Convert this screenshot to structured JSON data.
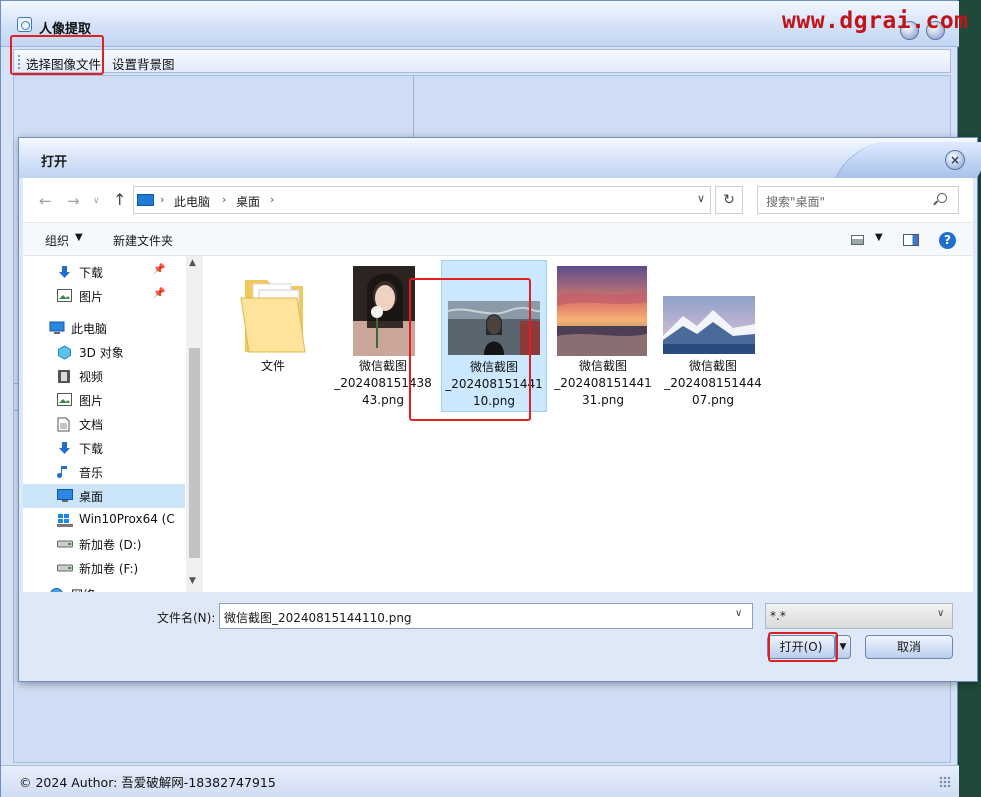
{
  "app": {
    "title": "人像提取",
    "watermark": "www.dgrai.com",
    "menu": {
      "select_image": "选择图像文件",
      "set_background": "设置背景图"
    },
    "status": "© 2024 Author: 吾爱破解网-18382747915"
  },
  "dialog": {
    "title": "打开",
    "close_glyph": "×",
    "breadcrumb": [
      "此电脑",
      "桌面"
    ],
    "search_placeholder": "搜索\"桌面\"",
    "toolbar": {
      "organize": "组织",
      "new_folder": "新建文件夹",
      "help": "?"
    },
    "nav_tree": [
      {
        "label": "下载",
        "icon": "download-arrow-icon",
        "pinned": true
      },
      {
        "label": "图片",
        "icon": "picture-icon",
        "pinned": true
      },
      {
        "label": "此电脑",
        "icon": "computer-icon",
        "pinned": false
      },
      {
        "label": "3D 对象",
        "icon": "cube-3d-icon",
        "pinned": false
      },
      {
        "label": "视频",
        "icon": "film-icon",
        "pinned": false
      },
      {
        "label": "图片",
        "icon": "picture-icon",
        "pinned": false
      },
      {
        "label": "文档",
        "icon": "document-icon",
        "pinned": false
      },
      {
        "label": "下载",
        "icon": "download-arrow-icon",
        "pinned": false
      },
      {
        "label": "音乐",
        "icon": "music-note-icon",
        "pinned": false
      },
      {
        "label": "桌面",
        "icon": "desktop-icon",
        "pinned": false,
        "selected": true
      },
      {
        "label": "Win10Prox64 (C",
        "icon": "windows-drive-icon",
        "pinned": false
      },
      {
        "label": "新加卷 (D:)",
        "icon": "drive-icon",
        "pinned": false
      },
      {
        "label": "新加卷 (F:)",
        "icon": "drive-icon",
        "pinned": false
      },
      {
        "label": "网络",
        "icon": "network-icon",
        "pinned": false
      }
    ],
    "files": [
      {
        "name": "文件",
        "kind": "folder"
      },
      {
        "name": "微信截图_20240815143843.png",
        "kind": "image",
        "lines": [
          "微信截图",
          "_202408151438",
          "43.png"
        ]
      },
      {
        "name": "微信截图_20240815144110.png",
        "kind": "image",
        "selected": true,
        "lines": [
          "微信截图",
          "_202408151441",
          "10.png"
        ]
      },
      {
        "name": "微信截图_20240815144131.png",
        "kind": "image",
        "lines": [
          "微信截图",
          "_202408151441",
          "31.png"
        ]
      },
      {
        "name": "微信截图_20240815144407.png",
        "kind": "image",
        "lines": [
          "微信截图",
          "_202408151444",
          "07.png"
        ]
      }
    ],
    "filename_label": "文件名(N):",
    "filename_value": "微信截图_20240815144110.png",
    "filetype_value": "*.*",
    "open_button": "打开(O)",
    "cancel_button": "取消"
  },
  "colors": {
    "highlight_red": "#e02020",
    "selection_blue": "#cce8ff",
    "window_chrome": "#d6e3f7",
    "watermark_red": "#c0141b"
  }
}
